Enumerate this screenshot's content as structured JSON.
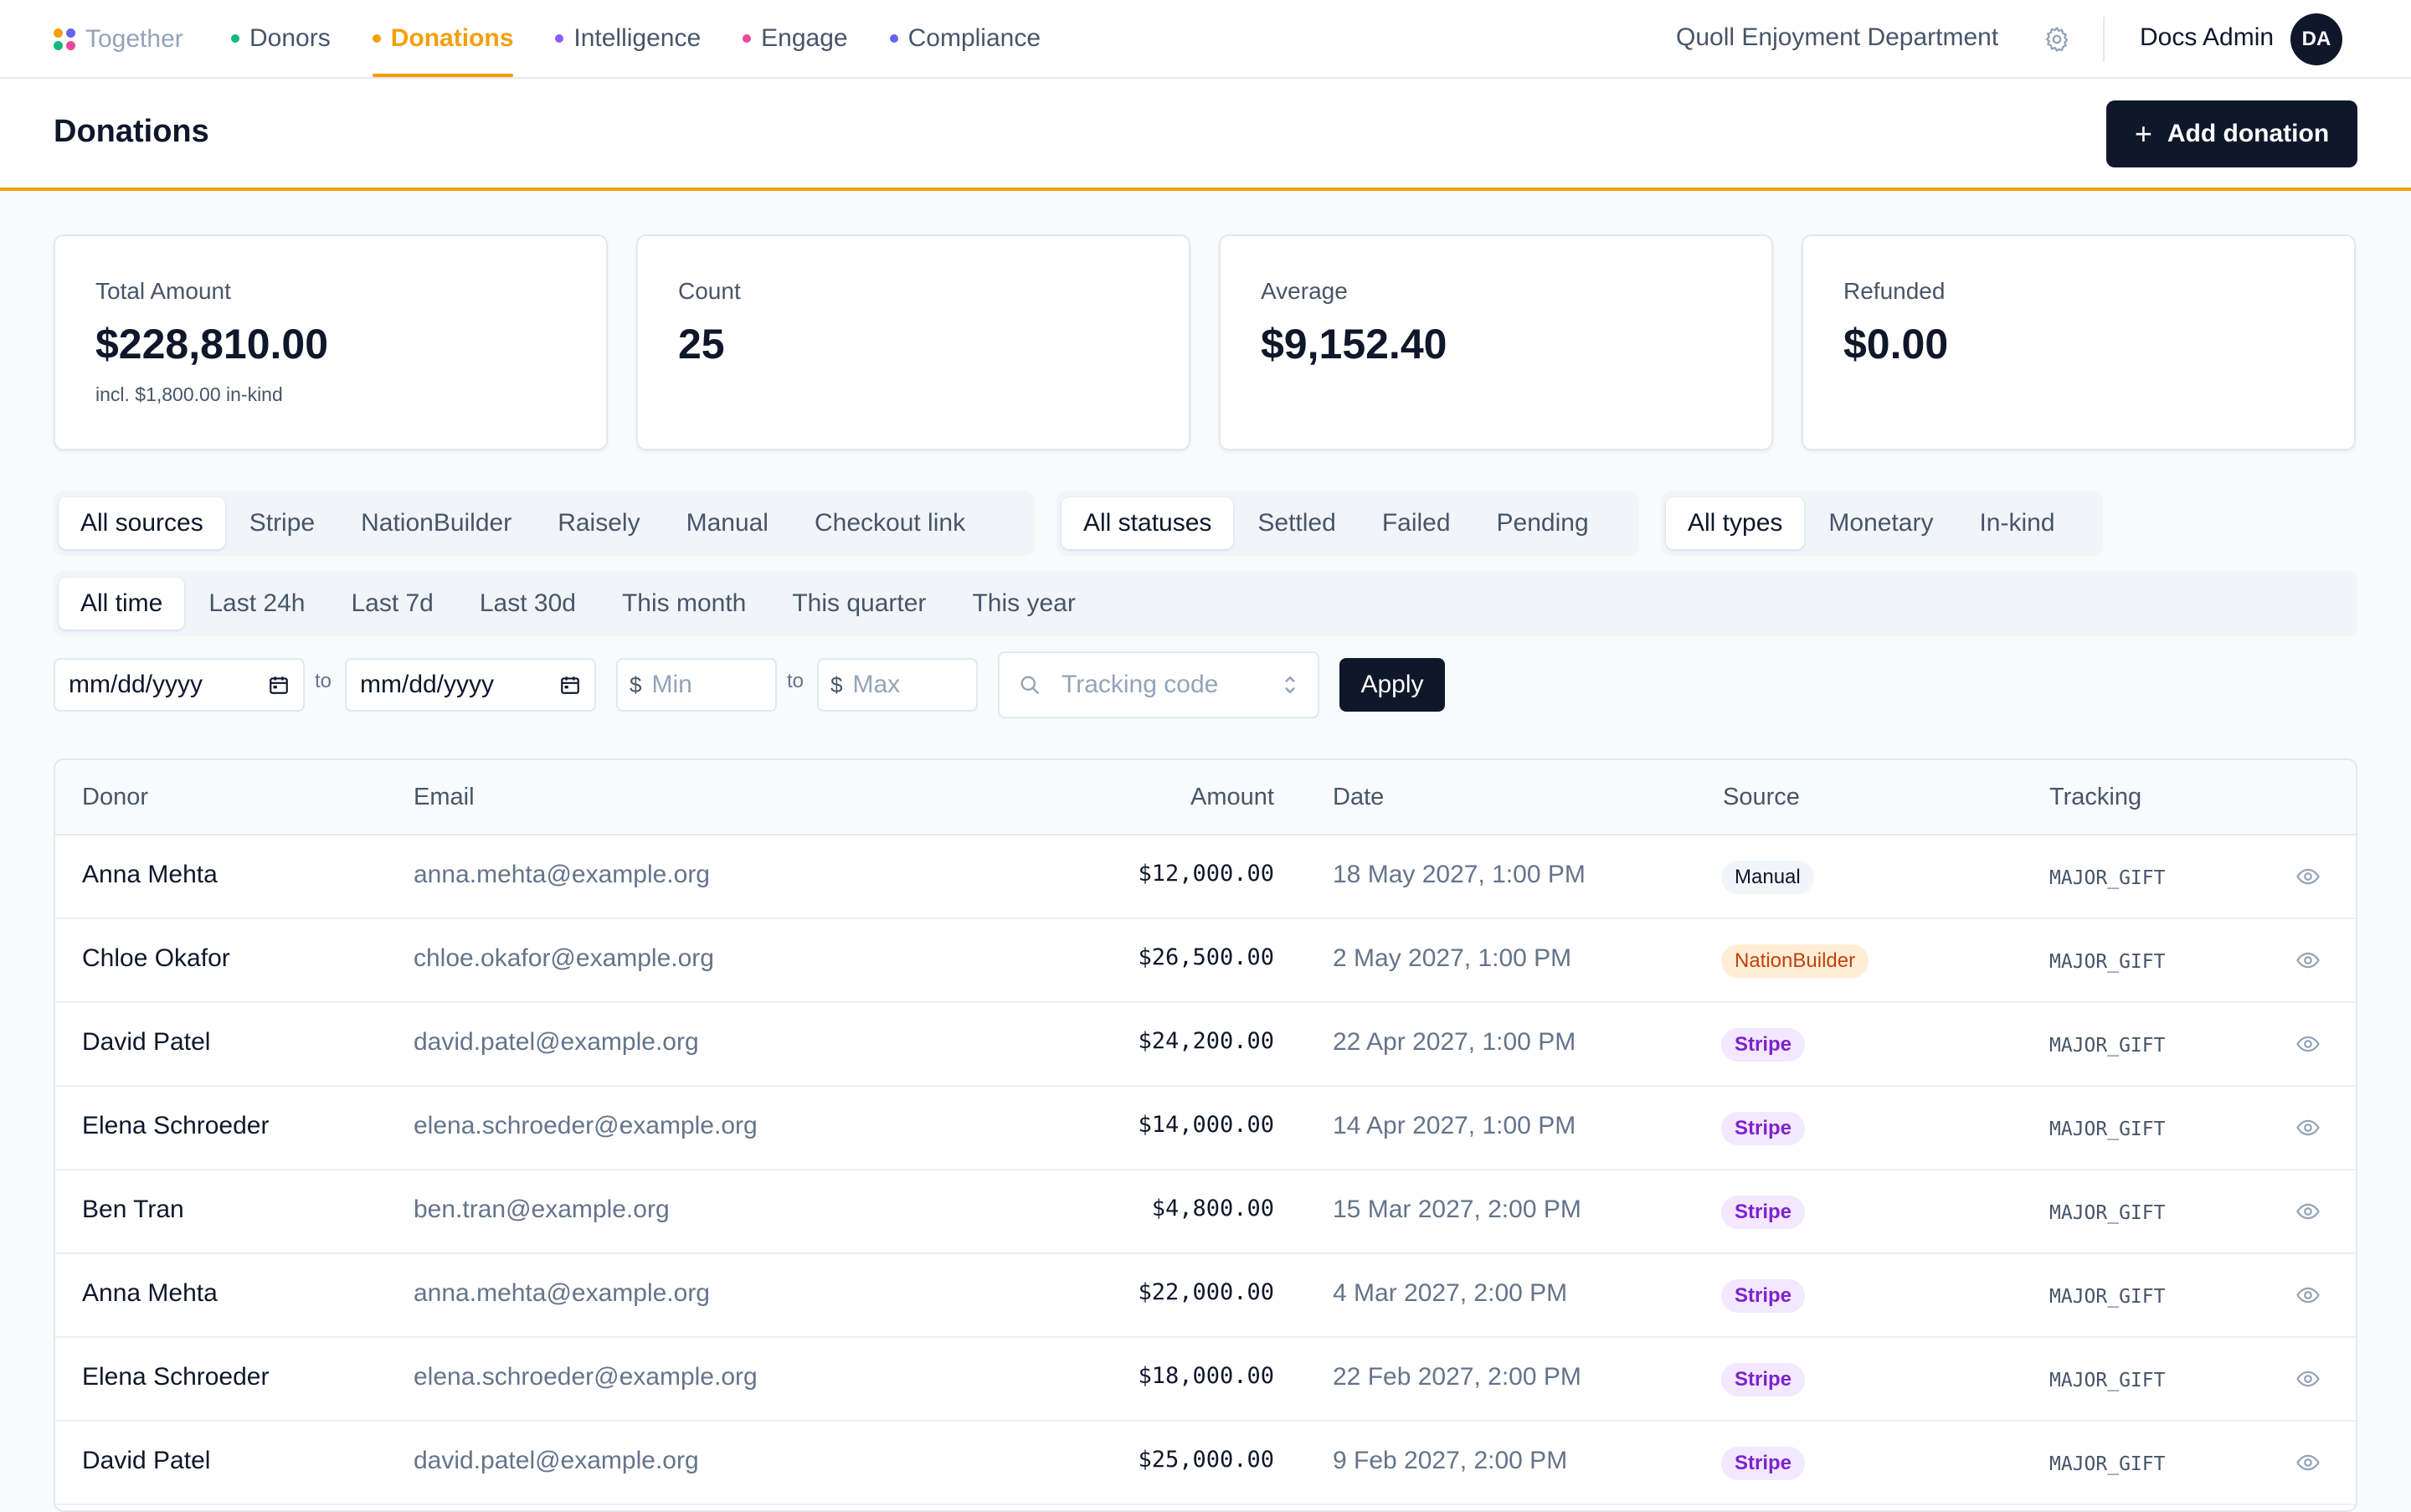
{
  "nav": {
    "brand": "Together",
    "items": [
      {
        "label": "Donors",
        "color": "#10b981",
        "active": false
      },
      {
        "label": "Donations",
        "color": "#f59e0b",
        "active": true
      },
      {
        "label": "Intelligence",
        "color": "#8b5cf6",
        "active": false
      },
      {
        "label": "Engage",
        "color": "#ec4899",
        "active": false
      },
      {
        "label": "Compliance",
        "color": "#6366f1",
        "active": false
      }
    ],
    "org": "Quoll Enjoyment Department",
    "settings_icon": "gear-icon",
    "user": "Docs Admin",
    "avatar": "DA"
  },
  "page": {
    "title": "Donations",
    "add_button": "Add donation",
    "accent": "#f59e0b"
  },
  "stats": [
    {
      "label": "Total Amount",
      "value": "$228,810.00",
      "sub": "incl. $1,800.00 in-kind"
    },
    {
      "label": "Count",
      "value": "25",
      "sub": ""
    },
    {
      "label": "Average",
      "value": "$9,152.40",
      "sub": ""
    },
    {
      "label": "Refunded",
      "value": "$0.00",
      "sub": ""
    }
  ],
  "filters": {
    "sources": [
      "All sources",
      "Stripe",
      "NationBuilder",
      "Raisely",
      "Manual",
      "Checkout link"
    ],
    "statuses": [
      "All statuses",
      "Settled",
      "Failed",
      "Pending"
    ],
    "types": [
      "All types",
      "Monetary",
      "In-kind"
    ],
    "periods": [
      "All time",
      "Last 24h",
      "Last 7d",
      "Last 30d",
      "This month",
      "This quarter",
      "This year"
    ],
    "date_placeholder": "mm/dd/yyyy",
    "to_label": "to",
    "currency": "$",
    "min_placeholder": "Min",
    "max_placeholder": "Max",
    "tracking_placeholder": "Tracking code",
    "apply": "Apply"
  },
  "table": {
    "headers": {
      "donor": "Donor",
      "email": "Email",
      "amount": "Amount",
      "date": "Date",
      "source": "Source",
      "tracking": "Tracking"
    },
    "rows": [
      {
        "donor": "Anna Mehta",
        "email": "anna.mehta@example.org",
        "amount": "$12,000.00",
        "date": "18 May 2027, 1:00 PM",
        "source": "Manual",
        "tracking": "MAJOR_GIFT"
      },
      {
        "donor": "Chloe Okafor",
        "email": "chloe.okafor@example.org",
        "amount": "$26,500.00",
        "date": "2 May 2027, 1:00 PM",
        "source": "NationBuilder",
        "tracking": "MAJOR_GIFT"
      },
      {
        "donor": "David Patel",
        "email": "david.patel@example.org",
        "amount": "$24,200.00",
        "date": "22 Apr 2027, 1:00 PM",
        "source": "Stripe",
        "tracking": "MAJOR_GIFT"
      },
      {
        "donor": "Elena Schroeder",
        "email": "elena.schroeder@example.org",
        "amount": "$14,000.00",
        "date": "14 Apr 2027, 1:00 PM",
        "source": "Stripe",
        "tracking": "MAJOR_GIFT"
      },
      {
        "donor": "Ben Tran",
        "email": "ben.tran@example.org",
        "amount": "$4,800.00",
        "date": "15 Mar 2027, 2:00 PM",
        "source": "Stripe",
        "tracking": "MAJOR_GIFT"
      },
      {
        "donor": "Anna Mehta",
        "email": "anna.mehta@example.org",
        "amount": "$22,000.00",
        "date": "4 Mar 2027, 2:00 PM",
        "source": "Stripe",
        "tracking": "MAJOR_GIFT"
      },
      {
        "donor": "Elena Schroeder",
        "email": "elena.schroeder@example.org",
        "amount": "$18,000.00",
        "date": "22 Feb 2027, 2:00 PM",
        "source": "Stripe",
        "tracking": "MAJOR_GIFT"
      },
      {
        "donor": "David Patel",
        "email": "david.patel@example.org",
        "amount": "$25,000.00",
        "date": "9 Feb 2027, 2:00 PM",
        "source": "Stripe",
        "tracking": "MAJOR_GIFT"
      }
    ]
  }
}
